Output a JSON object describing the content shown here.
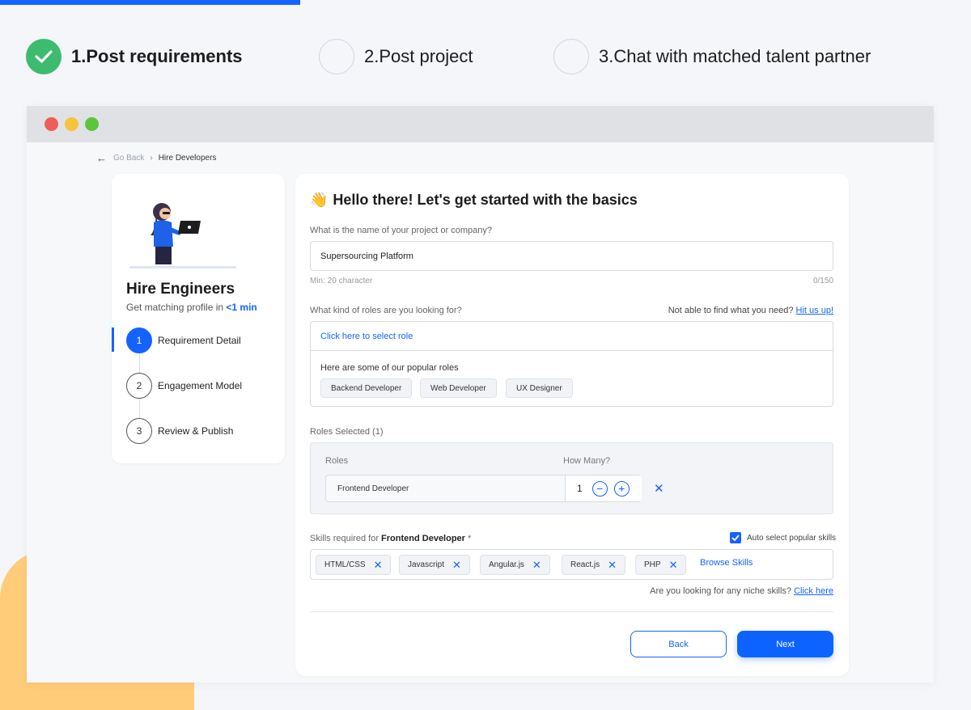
{
  "top_steps": [
    {
      "label": "1.Post requirements",
      "done": true
    },
    {
      "label": "2.Post project",
      "done": false
    },
    {
      "label": "3.Chat with matched talent partner",
      "done": false
    }
  ],
  "breadcrumb": {
    "back": "Go Back",
    "current": "Hire Developers"
  },
  "sidebar": {
    "title": "Hire Engineers",
    "subtitle_prefix": "Get matching profile in",
    "subtitle_highlight": "<1 min",
    "steps": [
      {
        "num": "1",
        "label": "Requirement Detail",
        "active": true
      },
      {
        "num": "2",
        "label": "Engagement Model",
        "active": false
      },
      {
        "num": "3",
        "label": "Review & Publish",
        "active": false
      }
    ]
  },
  "form": {
    "title": "Hello there! Let's get started with the basics",
    "title_emoji": "👋",
    "project_question": "What is the name of your project or company?",
    "project_value": "Supersourcing Platform",
    "min_hint": "Min: 20 character",
    "char_count": "0/150",
    "roles_question": "What kind of roles are you looking for?",
    "not_found_text": "Not able to find what you need?",
    "not_found_link": "Hit us up!",
    "select_role": "Click here to select role",
    "popular_label": "Here are some of our popular roles",
    "popular_roles": [
      "Backend Developer",
      "Web Developer",
      "UX Designer"
    ],
    "roles_selected_label": "Roles Selected (1)",
    "col_roles": "Roles",
    "col_how_many": "How Many?",
    "selected_role": "Frontend Developer",
    "selected_qty": "1",
    "skills_prefix": "Skills required for",
    "skills_role": "Frontend Developer",
    "skills_required_mark": "*",
    "auto_select_label": "Auto select popular skills",
    "auto_select_checked": true,
    "skills": [
      "HTML/CSS",
      "Javascript",
      "Angular.js",
      "React.js",
      "PHP"
    ],
    "browse_skills": "Browse Skills",
    "niche_text": "Are you looking for any niche skills?",
    "niche_link": "Click here",
    "back_label": "Back",
    "next_label": "Next"
  },
  "colors": {
    "accent": "#1463ff",
    "success": "#3dbb6e",
    "window_red": "#ee5d59",
    "window_yellow": "#f6c33d",
    "window_green": "#5dc43d",
    "decor_orange": "#ffcc7a"
  }
}
